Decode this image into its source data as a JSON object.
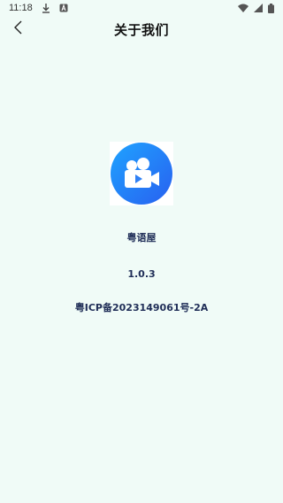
{
  "status_bar": {
    "time": "11:18",
    "icons": [
      "download-icon",
      "notification-a-icon",
      "wifi-icon",
      "signal-icon",
      "battery-icon"
    ]
  },
  "header": {
    "title": "关于我们",
    "back_icon": "chevron-left-icon"
  },
  "about": {
    "app_name": "粤语屋",
    "version": "1.0.3",
    "icp": "粤ICP备2023149061号-2A"
  },
  "colors": {
    "background": "#f0fbf7",
    "text": "#1f2d57",
    "icon_gradient_start": "#1fa3ff",
    "icon_gradient_end": "#2860f0"
  }
}
